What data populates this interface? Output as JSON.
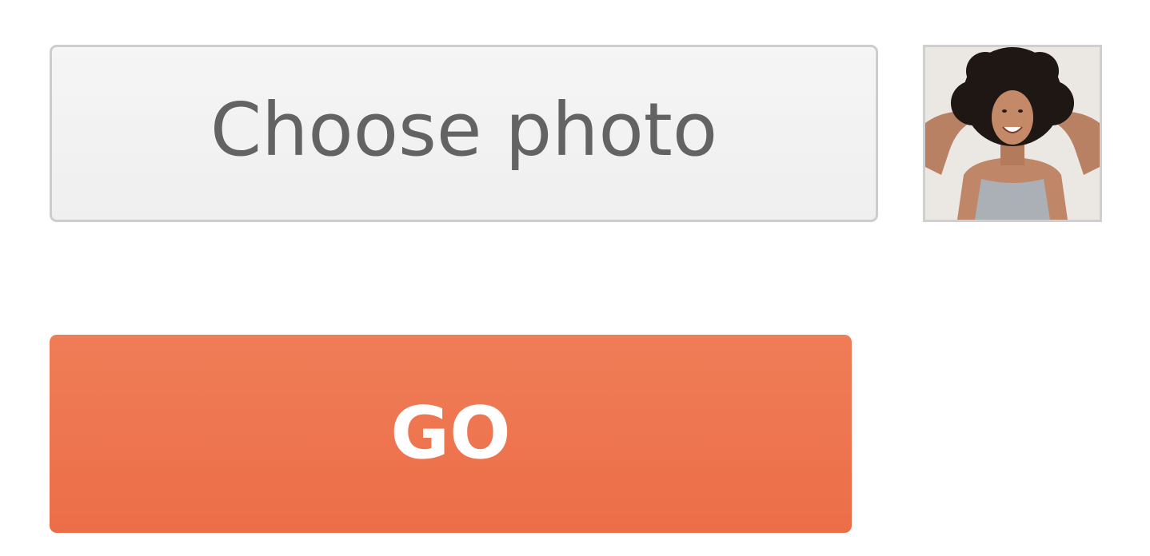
{
  "upload": {
    "choose_label": "Choose photo"
  },
  "preview": {
    "icon": "photo-thumbnail"
  },
  "submit": {
    "go_label": "GO"
  },
  "colors": {
    "go_button": "#ec7049",
    "choose_button": "#f1f1f1",
    "choose_text": "#636363"
  }
}
